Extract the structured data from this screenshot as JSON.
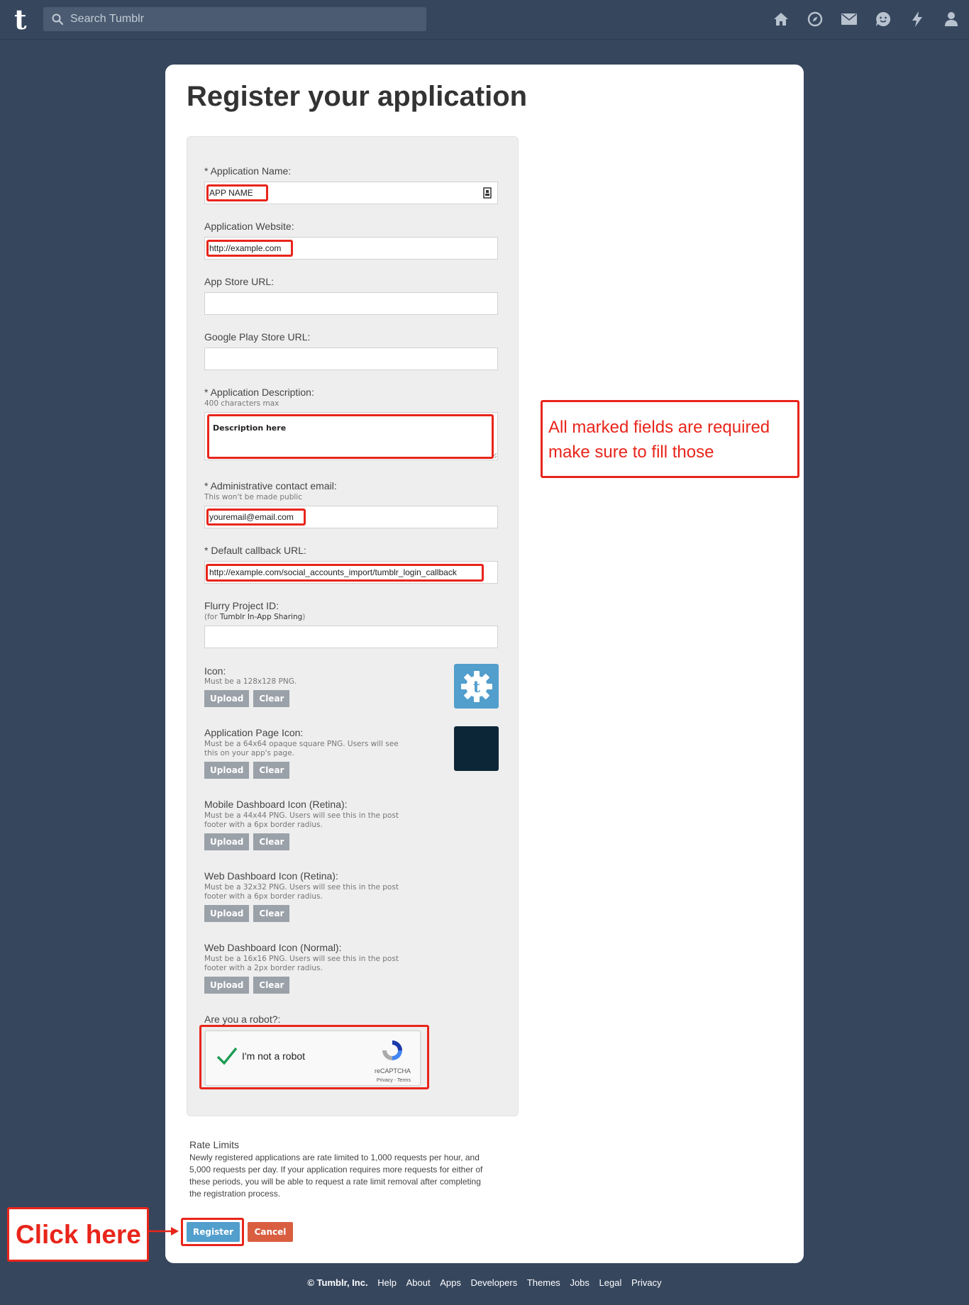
{
  "header": {
    "logo": "t",
    "search_placeholder": "Search Tumblr",
    "nav_icons": [
      "home-icon",
      "explore-icon",
      "inbox-icon",
      "messages-icon",
      "activity-icon",
      "account-icon"
    ]
  },
  "page": {
    "title": "Register your application"
  },
  "form": {
    "app_name": {
      "label": "* Application Name:",
      "value": "APP NAME"
    },
    "app_website": {
      "label": "Application Website:",
      "value": "http://example.com"
    },
    "app_store_url": {
      "label": "App Store URL:",
      "value": ""
    },
    "google_play_url": {
      "label": "Google Play Store URL:",
      "value": ""
    },
    "description": {
      "label": "* Application Description:",
      "hint": "400 characters max",
      "value": "Description here"
    },
    "admin_email": {
      "label": "* Administrative contact email:",
      "hint": "This won't be made public",
      "value": "youremail@email.com"
    },
    "callback_url": {
      "label": "* Default callback URL:",
      "value": "http://example.com/social_accounts_import/tumblr_login_callback"
    },
    "flurry": {
      "label": "Flurry Project ID:",
      "hint_prefix": "(for ",
      "hint_strong": "Tumblr In-App Sharing",
      "hint_suffix": ")",
      "value": ""
    },
    "icon": {
      "label": "Icon:",
      "hint": "Must be a 128x128 PNG."
    },
    "page_icon": {
      "label": "Application Page Icon:",
      "hint_line1": "Must be a 64x64 opaque square PNG. Users will see",
      "hint_line2": "this on your app's page."
    },
    "mobile_icon": {
      "label": "Mobile Dashboard Icon (Retina):",
      "hint_line1": "Must be a 44x44 PNG. Users will see this in the post",
      "hint_line2": "footer with a 6px border radius."
    },
    "web_retina_icon": {
      "label": "Web Dashboard Icon (Retina):",
      "hint_line1": "Must be a 32x32 PNG. Users will see this in the post",
      "hint_line2": "footer with a 6px border radius."
    },
    "web_normal_icon": {
      "label": "Web Dashboard Icon (Normal):",
      "hint_line1": "Must be a 16x16 PNG. Users will see this in the post",
      "hint_line2": "footer with a 2px border radius."
    },
    "upload_label": "Upload",
    "clear_label": "Clear",
    "robot": {
      "label": "Are you a robot?:",
      "checkbox_label": "I'm not a robot",
      "brand": "reCAPTCHA",
      "terms": "Privacy - Terms"
    }
  },
  "rate_limits": {
    "title": "Rate Limits",
    "text": "Newly registered applications are rate limited to 1,000 requests per hour, and 5,000 requests per day. If your application requires more requests for either of these periods, you will be able to request a rate limit removal after completing the registration process."
  },
  "actions": {
    "register_label": "Register",
    "cancel_label": "Cancel"
  },
  "footer": {
    "copyright": "© Tumblr, Inc.",
    "links": [
      "Help",
      "About",
      "Apps",
      "Developers",
      "Themes",
      "Jobs",
      "Legal",
      "Privacy"
    ]
  },
  "annotations": {
    "required_note_line1": "All marked fields are required",
    "required_note_line2": "make sure to fill those",
    "click_note": "Click here",
    "color": "#e8251b"
  }
}
